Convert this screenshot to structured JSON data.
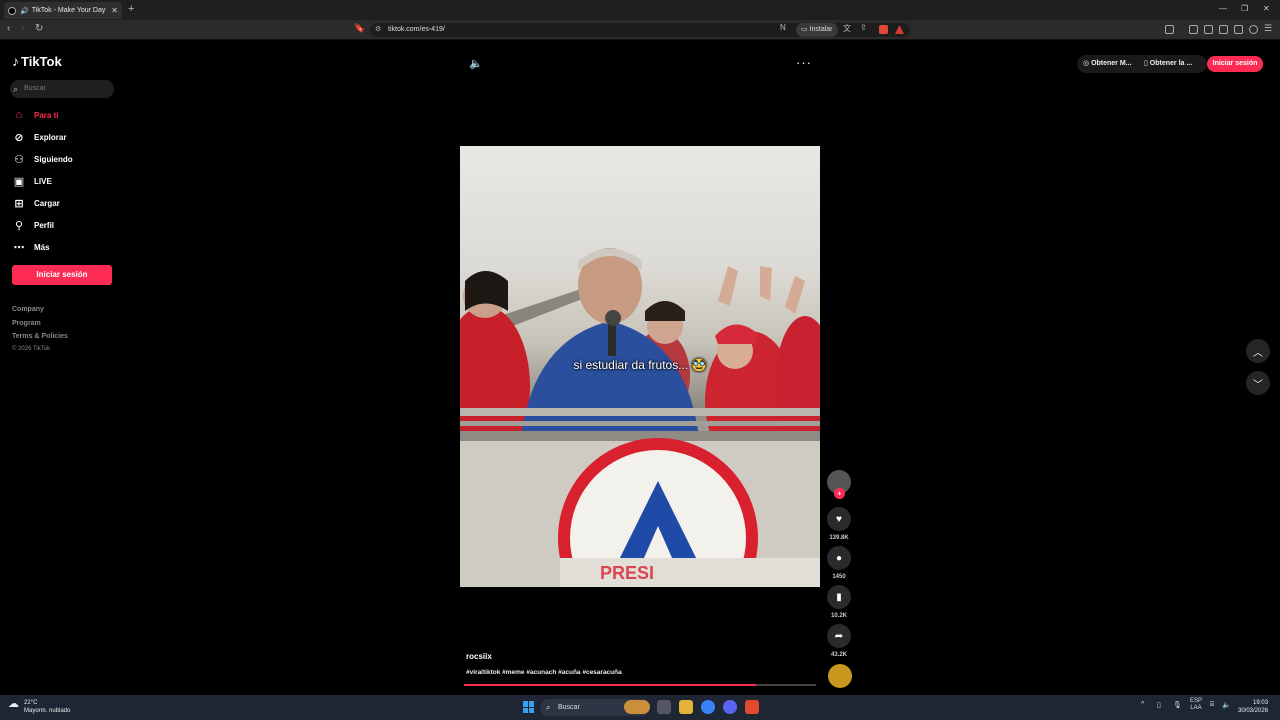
{
  "browser": {
    "tab_title": "TikTok - Make Your Day",
    "new_tab_symbol": "+",
    "url": "tiktok.com/es-419/",
    "install_label": "Instalar"
  },
  "sidebar": {
    "logo_text": "TikTok",
    "search_placeholder": "Buscar",
    "items": [
      {
        "label": "Para ti",
        "icon": "home-icon"
      },
      {
        "label": "Explorar",
        "icon": "compass-icon"
      },
      {
        "label": "Siguiendo",
        "icon": "following-icon"
      },
      {
        "label": "LIVE",
        "icon": "live-icon"
      },
      {
        "label": "Cargar",
        "icon": "upload-icon"
      },
      {
        "label": "Perfil",
        "icon": "profile-icon"
      },
      {
        "label": "Más",
        "icon": "more-icon"
      }
    ],
    "login_label": "Iniciar sesión",
    "footer": [
      "Company",
      "Program",
      "Terms & Policies"
    ],
    "copyright": "© 2026 TikTok"
  },
  "header": {
    "get_app_label": "Obtener M...",
    "get_desktop_label": "Obtener la ...",
    "signin_label": "Iniciar sesión"
  },
  "video": {
    "caption": "si estudiar da frutos... 🥸",
    "author": "rocsiix",
    "hashtags": "#viraltiktok #meme #acunach #acuña #cesaracuña",
    "progress_fraction": 0.83
  },
  "actions": {
    "likes": "139.8K",
    "comments": "1450",
    "saves": "10.2K",
    "shares": "43.2K"
  },
  "taskbar": {
    "temperature": "22°C",
    "weather": "Mayorm. nublado",
    "search_label": "Buscar",
    "lang": "ESP",
    "lang_sub": "LAA",
    "time": "19:03",
    "date": "30/03/2026"
  },
  "colors": {
    "accent": "#fe2c55",
    "background": "#000000"
  }
}
